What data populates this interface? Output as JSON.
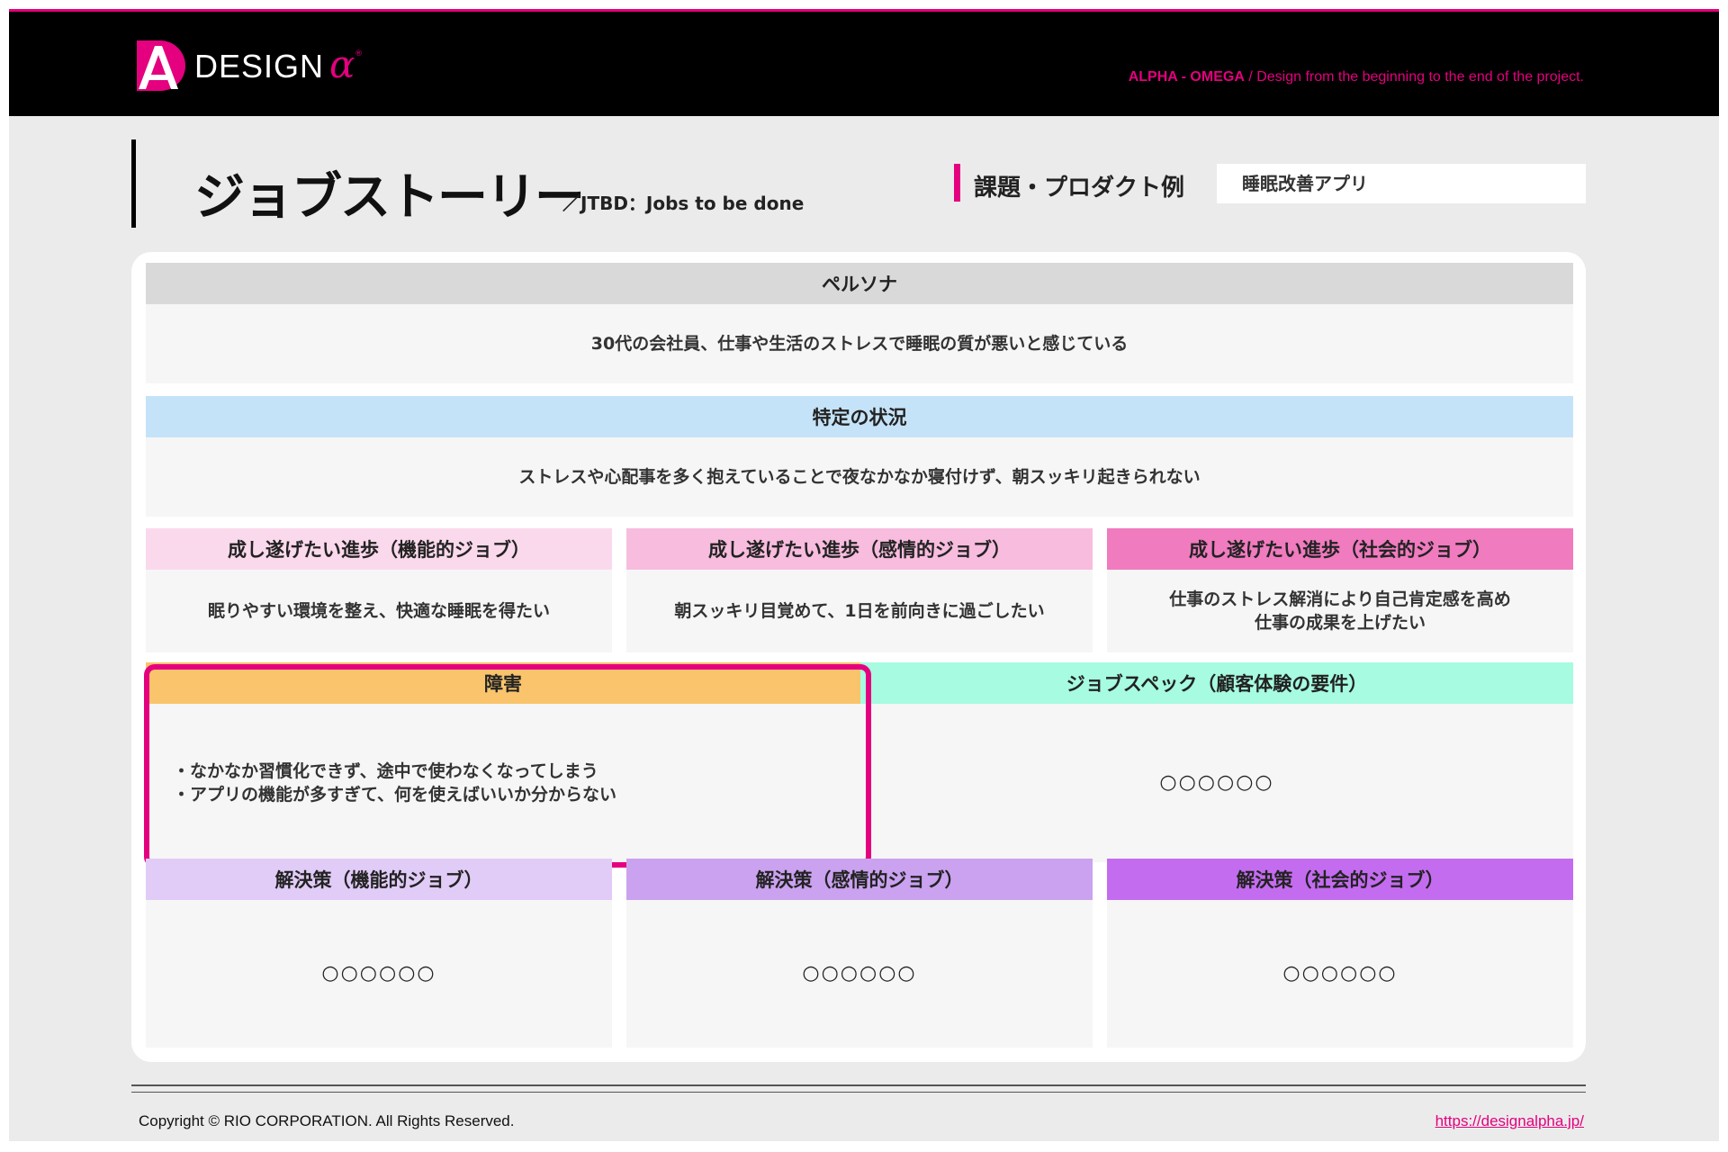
{
  "header": {
    "logo_text": "DESIGN",
    "logo_alpha": "α",
    "logo_reg": "®",
    "tagline_strong": "ALPHA - OMEGA",
    "tagline_rest": " / Design from the beginning to the end of the project."
  },
  "title": {
    "main": "ジョブストーリー",
    "sub": "／JTBD：Jobs to be done",
    "issue_label": "課題・プロダクト例",
    "issue_value": "睡眠改善アプリ"
  },
  "colors": {
    "accent": "#e4007f",
    "persona_head": "#d9d9d9",
    "situation_head": "#c5e3f8",
    "func_progress_head": "#fbd9ec",
    "emo_progress_head": "#f7bcde",
    "soc_progress_head": "#f07bbf",
    "obstacle_head": "#f9c46b",
    "spec_head": "#a6fbe0",
    "func_solution_head": "#e1cbf7",
    "emo_solution_head": "#caa2f0",
    "soc_solution_head": "#c46cf0"
  },
  "sections": {
    "persona": {
      "title": "ペルソナ",
      "body": "30代の会社員、仕事や生活のストレスで睡眠の質が悪いと感じている"
    },
    "situation": {
      "title": "特定の状況",
      "body": "ストレスや心配事を多く抱えていることで夜なかなか寝付けず、朝スッキリ起きられない"
    },
    "progress_functional": {
      "title": "成し遂げたい進歩（機能的ジョブ）",
      "body": "眠りやすい環境を整え、快適な睡眠を得たい"
    },
    "progress_emotional": {
      "title": "成し遂げたい進歩（感情的ジョブ）",
      "body": "朝スッキリ目覚めて、1日を前向きに過ごしたい"
    },
    "progress_social": {
      "title": "成し遂げたい進歩（社会的ジョブ）",
      "body": "仕事のストレス解消により自己肯定感を高め\n仕事の成果を上げたい"
    },
    "obstacle": {
      "title": "障害",
      "body": "・なかなか習慣化できず、途中で使わなくなってしまう\n・アプリの機能が多すぎて、何を使えばいいか分からない"
    },
    "job_spec": {
      "title": "ジョブスペック（顧客体験の要件）",
      "body": "○○○○○○"
    },
    "solution_functional": {
      "title": "解決策（機能的ジョブ）",
      "body": "○○○○○○"
    },
    "solution_emotional": {
      "title": "解決策（感情的ジョブ）",
      "body": "○○○○○○"
    },
    "solution_social": {
      "title": "解決策（社会的ジョブ）",
      "body": "○○○○○○"
    }
  },
  "footer": {
    "copyright": "Copyright © RIO CORPORATION. All Rights Reserved.",
    "site": "https://designalpha.jp/"
  }
}
